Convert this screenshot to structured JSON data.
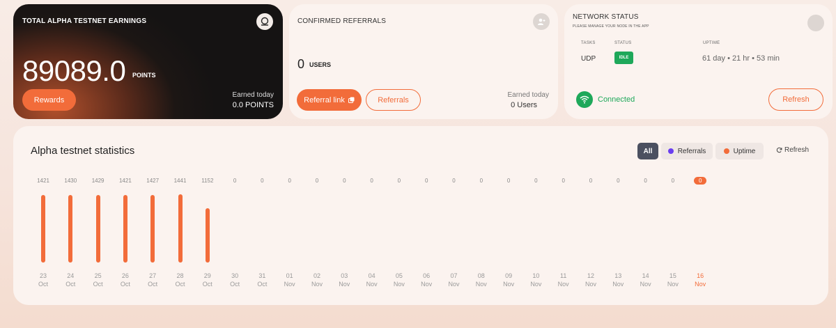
{
  "earnings": {
    "title": "TOTAL ALPHA TESTNET EARNINGS",
    "value": "89089.0",
    "unit": "POINTS",
    "rewards_label": "Rewards",
    "today_label": "Earned today",
    "today_value": "0.0 POINTS"
  },
  "referrals": {
    "title": "CONFIRMED REFERRALS",
    "count": "0",
    "unit": "USERS",
    "link_label": "Referral link",
    "referrals_label": "Referrals",
    "today_label": "Earned today",
    "today_value": "0 Users"
  },
  "network": {
    "title": "NETWORK STATUS",
    "subtitle": "PLEASE MANAGE YOUR NODE IN THE APP",
    "tasks_head": "TASKS",
    "status_head": "STATUS",
    "uptime_head": "UPTIME",
    "task": "UDP",
    "status": "IDLE",
    "uptime": "61 day • 21 hr • 53 min",
    "connection": "Connected",
    "refresh_label": "Refresh"
  },
  "stats": {
    "title": "Alpha testnet statistics",
    "filters": {
      "all": "All",
      "referrals": "Referrals",
      "uptime": "Uptime"
    },
    "refresh_label": "Refresh"
  },
  "colors": {
    "accent": "#f26c3a",
    "success": "#1ea85a",
    "referral": "#6a3df0"
  },
  "chart_data": {
    "type": "bar",
    "categories": [
      "23 Oct",
      "24 Oct",
      "25 Oct",
      "26 Oct",
      "27 Oct",
      "28 Oct",
      "29 Oct",
      "30 Oct",
      "31 Oct",
      "01 Nov",
      "02 Nov",
      "03 Nov",
      "04 Nov",
      "05 Nov",
      "06 Nov",
      "07 Nov",
      "08 Nov",
      "09 Nov",
      "10 Nov",
      "11 Nov",
      "12 Nov",
      "13 Nov",
      "14 Nov",
      "15 Nov",
      "16 Nov"
    ],
    "x_day": [
      "23",
      "24",
      "25",
      "26",
      "27",
      "28",
      "29",
      "30",
      "31",
      "01",
      "02",
      "03",
      "04",
      "05",
      "06",
      "07",
      "08",
      "09",
      "10",
      "11",
      "12",
      "13",
      "14",
      "15",
      "16"
    ],
    "x_month": [
      "Oct",
      "Oct",
      "Oct",
      "Oct",
      "Oct",
      "Oct",
      "Oct",
      "Oct",
      "Oct",
      "Nov",
      "Nov",
      "Nov",
      "Nov",
      "Nov",
      "Nov",
      "Nov",
      "Nov",
      "Nov",
      "Nov",
      "Nov",
      "Nov",
      "Nov",
      "Nov",
      "Nov",
      "Nov"
    ],
    "values": [
      1421,
      1430,
      1429,
      1421,
      1427,
      1441,
      1152,
      0,
      0,
      0,
      0,
      0,
      0,
      0,
      0,
      0,
      0,
      0,
      0,
      0,
      0,
      0,
      0,
      0,
      0
    ],
    "value_labels": [
      "1421",
      "1430",
      "1429",
      "1421",
      "1427",
      "1441",
      "1152",
      "0",
      "0",
      "0",
      "0",
      "0",
      "0",
      "0",
      "0",
      "0",
      "0",
      "0",
      "0",
      "0",
      "0",
      "0",
      "0",
      "0",
      "0"
    ],
    "active_index": 24,
    "series_color": "#f26c3a"
  }
}
